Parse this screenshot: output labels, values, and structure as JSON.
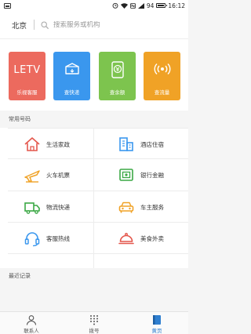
{
  "status_bar": {
    "battery": "94",
    "time": "16:12",
    "battery_level": 0.94
  },
  "top_bar": {
    "city": "北京",
    "search_placeholder": "搜索服务或机构"
  },
  "tiles": [
    {
      "label": "乐视客服",
      "logo_text": "LETV",
      "color": "#ec6a5e",
      "icon": "letv-logo"
    },
    {
      "label": "查快递",
      "color": "#3a97ee",
      "icon": "package-icon"
    },
    {
      "label": "查余额",
      "color": "#7dc44e",
      "icon": "balance-icon"
    },
    {
      "label": "查流量",
      "color": "#f0a226",
      "icon": "signal-icon"
    }
  ],
  "common_numbers": {
    "title": "常用号码",
    "items": [
      {
        "label": "生活家政",
        "icon": "house-icon"
      },
      {
        "label": "酒店住宿",
        "icon": "hotel-icon"
      },
      {
        "label": "火车机票",
        "icon": "plane-icon"
      },
      {
        "label": "银行金融",
        "icon": "safe-icon"
      },
      {
        "label": "物流快递",
        "icon": "truck-icon"
      },
      {
        "label": "车主服务",
        "icon": "car-icon"
      },
      {
        "label": "客服热线",
        "icon": "headset-icon"
      },
      {
        "label": "美食外卖",
        "icon": "food-cover-icon"
      }
    ]
  },
  "recent": {
    "title": "最近记录"
  },
  "bottom_nav": [
    {
      "label": "联系人",
      "icon": "person-icon",
      "active": false
    },
    {
      "label": "拨号",
      "icon": "dialpad-icon",
      "active": false
    },
    {
      "label": "黄页",
      "icon": "yellow-pages-icon",
      "active": true
    }
  ]
}
